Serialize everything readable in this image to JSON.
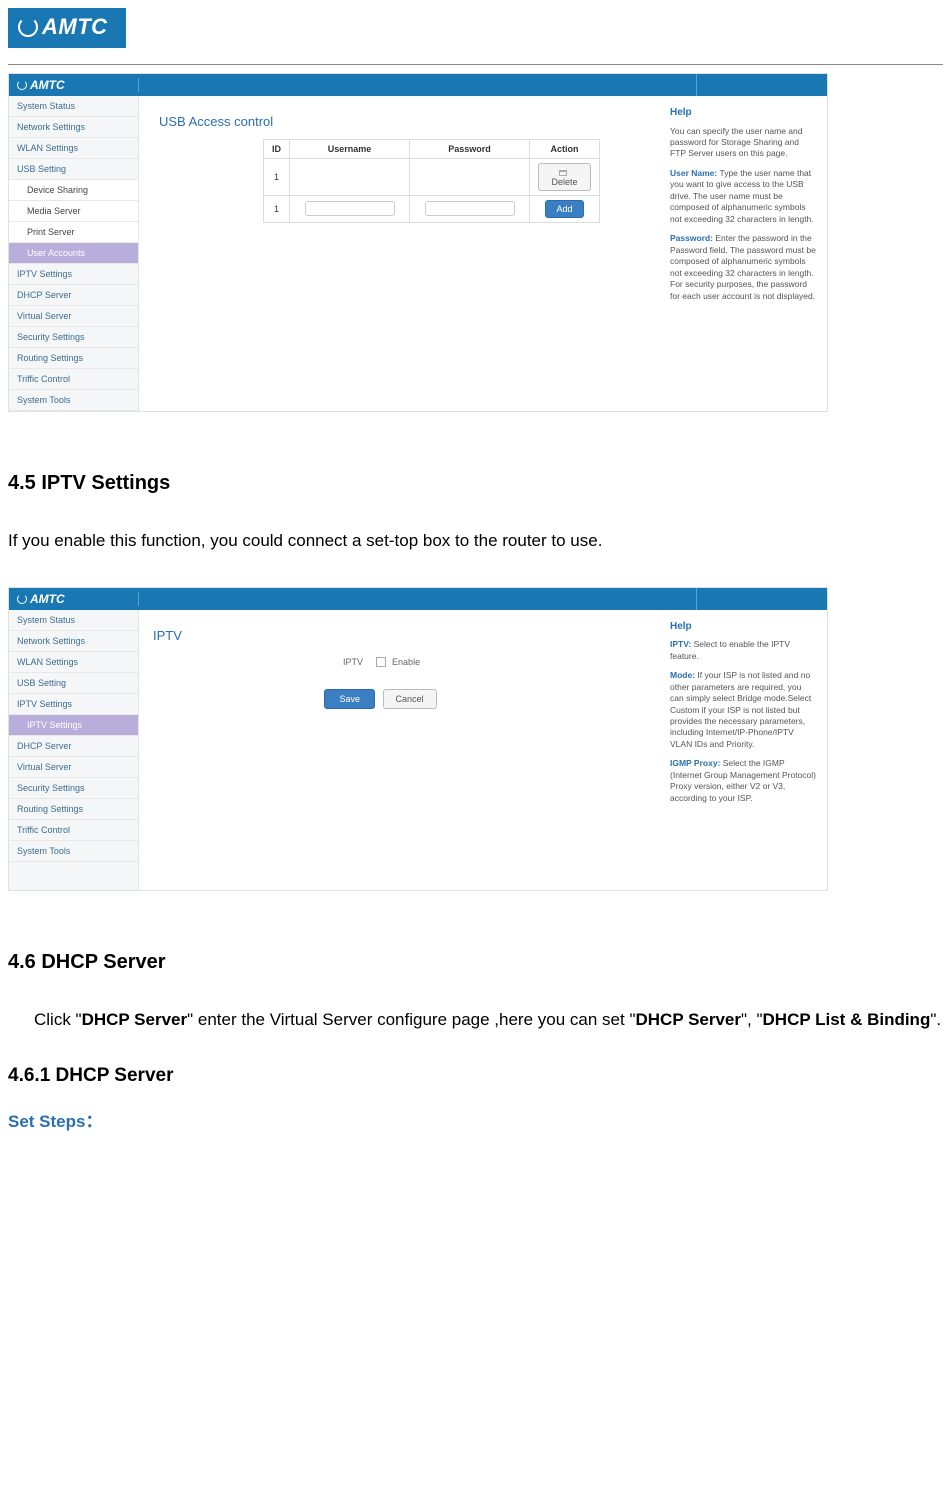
{
  "logo_text": "AMTC",
  "hr": true,
  "shot1": {
    "brand": "AMTC",
    "sidebar": [
      {
        "label": "System Status",
        "type": "item"
      },
      {
        "label": "Network Settings",
        "type": "item"
      },
      {
        "label": "WLAN Settings",
        "type": "item"
      },
      {
        "label": "USB Setting",
        "type": "item"
      },
      {
        "label": "Device Sharing",
        "type": "sub"
      },
      {
        "label": "Media Server",
        "type": "sub"
      },
      {
        "label": "Print Server",
        "type": "sub"
      },
      {
        "label": "User Accounts",
        "type": "sub-active"
      },
      {
        "label": "IPTV Settings",
        "type": "item"
      },
      {
        "label": "DHCP Server",
        "type": "item"
      },
      {
        "label": "Virtual Server",
        "type": "item"
      },
      {
        "label": "Security Settings",
        "type": "item"
      },
      {
        "label": "Routing Settings",
        "type": "item"
      },
      {
        "label": "Triffic Control",
        "type": "item"
      },
      {
        "label": "System Tools",
        "type": "item"
      }
    ],
    "title": "USB Access control",
    "table": {
      "headers": [
        "ID",
        "Username",
        "Password",
        "Action"
      ],
      "rows": [
        {
          "id": "1",
          "username": "",
          "password": "",
          "action_label": "Delete",
          "action_type": "delete"
        },
        {
          "id": "1",
          "username": "",
          "password": "",
          "action_label": "Add",
          "action_type": "add"
        }
      ]
    },
    "help": {
      "title": "Help",
      "p1": "You can specify the user name and password for Storage Sharing and FTP Server users on this page.",
      "t1": "User Name:",
      "p2": "Type the user name that you want to give access to the USB drive. The user name must be composed of alphanumeric symbols not exceeding 32 characters in length.",
      "t2": "Password:",
      "p3": "Enter the password in the Password field. The password must be composed of alphanumeric symbols not exceeding 32 characters in length. For security purposes, the password for each user account is not displayed."
    }
  },
  "sec45_title": "4.5 IPTV Settings",
  "sec45_body": "If you enable this function, you could connect a set-top box to the router to use.",
  "shot2": {
    "brand": "AMTC",
    "sidebar": [
      {
        "label": "System Status",
        "type": "item"
      },
      {
        "label": "Network Settings",
        "type": "item"
      },
      {
        "label": "WLAN Settings",
        "type": "item"
      },
      {
        "label": "USB Setting",
        "type": "item"
      },
      {
        "label": "IPTV Settings",
        "type": "item"
      },
      {
        "label": "IPTV Settings",
        "type": "sub-active"
      },
      {
        "label": "DHCP Server",
        "type": "item"
      },
      {
        "label": "Virtual Server",
        "type": "item"
      },
      {
        "label": "Security Settings",
        "type": "item"
      },
      {
        "label": "Routing Settings",
        "type": "item"
      },
      {
        "label": "Triffic Control",
        "type": "item"
      },
      {
        "label": "System Tools",
        "type": "item"
      }
    ],
    "title": "IPTV",
    "row_label": "IPTV",
    "enable_label": "Enable",
    "save_label": "Save",
    "cancel_label": "Cancel",
    "help": {
      "title": "Help",
      "t1": "IPTV:",
      "p1": "Select to enable the IPTV feature.",
      "t2": "Mode:",
      "p2": "If your ISP is not listed and no other parameters are required, you can simply select Bridge mode.Select Custom if your ISP is not listed but provides the necessary parameters, including Internet/IP-Phone/IPTV VLAN IDs and Priority.",
      "t3": "IGMP Proxy:",
      "p3": "Select the IGMP (Internet Group Management Protocol) Proxy version, either V2 or V3, according to your ISP."
    }
  },
  "sec46_title": "4.6 DHCP Server",
  "sec46_body_pre": "Click \"",
  "sec46_bold1": "DHCP Server",
  "sec46_body_mid1": "\" enter the Virtual Server configure page ,here you can set \"",
  "sec46_bold2": "DHCP Server",
  "sec46_body_mid2": "\", \"",
  "sec46_bold3": "DHCP List & Binding",
  "sec46_body_end": "\".",
  "sec461_title": "4.6.1 DHCP Server",
  "set_steps": "Set Steps："
}
